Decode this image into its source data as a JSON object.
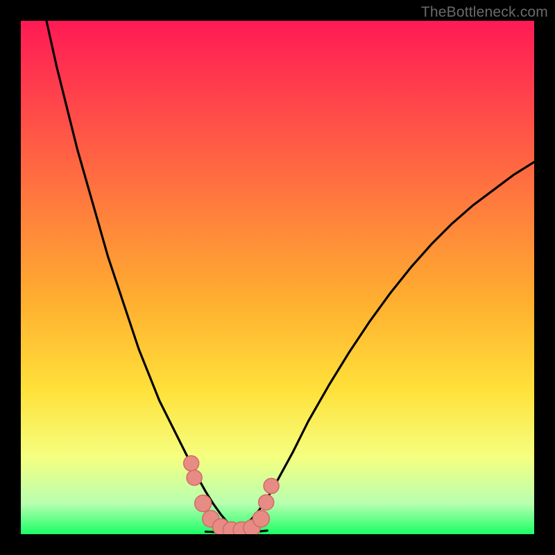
{
  "watermark": "TheBottleneck.com",
  "colors": {
    "black": "#000000",
    "curve": "#000000",
    "marker_fill": "#e78b85",
    "marker_stroke": "#d06a65",
    "grad_top": "#ff1a55",
    "grad_mid": "#ffd633",
    "grad_bottom": "#1aff66"
  },
  "chart_data": {
    "type": "line",
    "title": "",
    "xlabel": "",
    "ylabel": "",
    "xlim": [
      0,
      100
    ],
    "ylim": [
      0,
      100
    ],
    "gradient_stops": [
      {
        "offset": 0,
        "color": "#ff1a55"
      },
      {
        "offset": 55,
        "color": "#ffb030"
      },
      {
        "offset": 72,
        "color": "#ffe13a"
      },
      {
        "offset": 85,
        "color": "#f5ff80"
      },
      {
        "offset": 94,
        "color": "#b8ffb0"
      },
      {
        "offset": 100,
        "color": "#1aff66"
      }
    ],
    "series": [
      {
        "name": "left-curve",
        "x": [
          5,
          7,
          9,
          11,
          13,
          15,
          17,
          19,
          21,
          23,
          25,
          27,
          29,
          31,
          33,
          34.5,
          36,
          37.5,
          39,
          40.5,
          42
        ],
        "y": [
          100,
          91,
          83,
          75,
          68,
          61,
          54,
          48,
          42,
          36,
          31,
          26,
          22,
          18,
          14,
          11,
          8.3,
          5.9,
          3.8,
          2.0,
          0.7
        ]
      },
      {
        "name": "right-curve",
        "x": [
          42,
          43.5,
          45,
          46.5,
          48,
          50,
          53,
          56,
          60,
          64,
          68,
          72,
          76,
          80,
          84,
          88,
          92,
          96,
          100
        ],
        "y": [
          0.7,
          1.6,
          3.0,
          4.8,
          7.0,
          10.5,
          16,
          22,
          29,
          35.5,
          41.5,
          47,
          52,
          56.5,
          60.5,
          64,
          67,
          70,
          72.5
        ]
      },
      {
        "name": "bottom-flat",
        "x": [
          36,
          38,
          40,
          42,
          44,
          46,
          48
        ],
        "y": [
          0.5,
          0.4,
          0.4,
          0.4,
          0.4,
          0.5,
          0.7
        ]
      }
    ],
    "markers": [
      {
        "x": 33.2,
        "y": 13.8,
        "r": 11
      },
      {
        "x": 33.8,
        "y": 11.0,
        "r": 11
      },
      {
        "x": 35.5,
        "y": 6.0,
        "r": 12
      },
      {
        "x": 37.0,
        "y": 3.0,
        "r": 12
      },
      {
        "x": 39.0,
        "y": 1.4,
        "r": 12
      },
      {
        "x": 41.0,
        "y": 0.8,
        "r": 12
      },
      {
        "x": 43.0,
        "y": 0.8,
        "r": 12
      },
      {
        "x": 45.0,
        "y": 1.2,
        "r": 12
      },
      {
        "x": 46.8,
        "y": 3.0,
        "r": 12
      },
      {
        "x": 47.8,
        "y": 6.2,
        "r": 11
      },
      {
        "x": 48.8,
        "y": 9.4,
        "r": 11
      }
    ]
  }
}
